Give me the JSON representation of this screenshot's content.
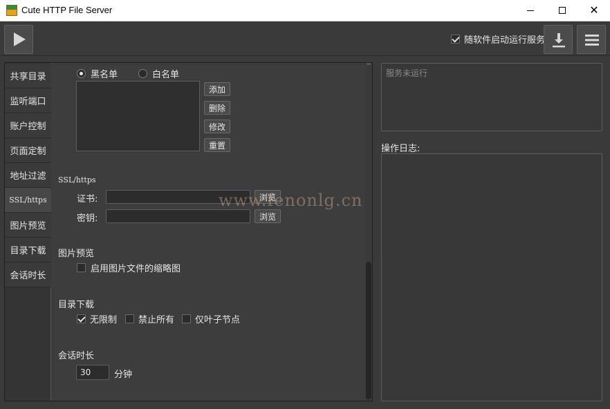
{
  "window": {
    "title": "Cute HTTP File Server",
    "minimize_glyph": "",
    "close_glyph": "✕"
  },
  "toolbar": {
    "autostart_label": "随软件启动运行服务",
    "autostart_checked": true
  },
  "tabs": [
    {
      "label": "共享目录"
    },
    {
      "label": "监听端口"
    },
    {
      "label": "账户控制"
    },
    {
      "label": "页面定制"
    },
    {
      "label": "地址过滤"
    },
    {
      "label": "SSL/https",
      "active": true
    },
    {
      "label": "图片预览"
    },
    {
      "label": "目录下载"
    },
    {
      "label": "会话时长"
    }
  ],
  "address_filter": {
    "blacklist_label": "黑名单",
    "whitelist_label": "白名单",
    "selected": "blacklist",
    "buttons": {
      "add": "添加",
      "delete": "删除",
      "edit": "修改",
      "reset": "重置"
    }
  },
  "ssl": {
    "title": "SSL/https",
    "cert_label": "证书:",
    "key_label": "密钥:",
    "cert_value": "",
    "key_value": "",
    "browse_label": "浏览"
  },
  "image_preview": {
    "title": "图片预览",
    "thumbnail_label": "启用图片文件的缩略图",
    "thumbnail_checked": false
  },
  "dir_download": {
    "title": "目录下载",
    "options": [
      {
        "label": "无限制",
        "checked": true
      },
      {
        "label": "禁止所有",
        "checked": false
      },
      {
        "label": "仅叶子节点",
        "checked": false
      }
    ]
  },
  "session": {
    "title": "会话时长",
    "value": "30",
    "unit": "分钟"
  },
  "status": {
    "text": "服务未运行"
  },
  "log": {
    "label": "操作日志:"
  },
  "watermark": "www.fenonlg.cn",
  "icons": [
    "app-icon",
    "play-icon",
    "download-icon",
    "menu-icon",
    "minimize-icon",
    "maximize-icon",
    "close-icon"
  ]
}
